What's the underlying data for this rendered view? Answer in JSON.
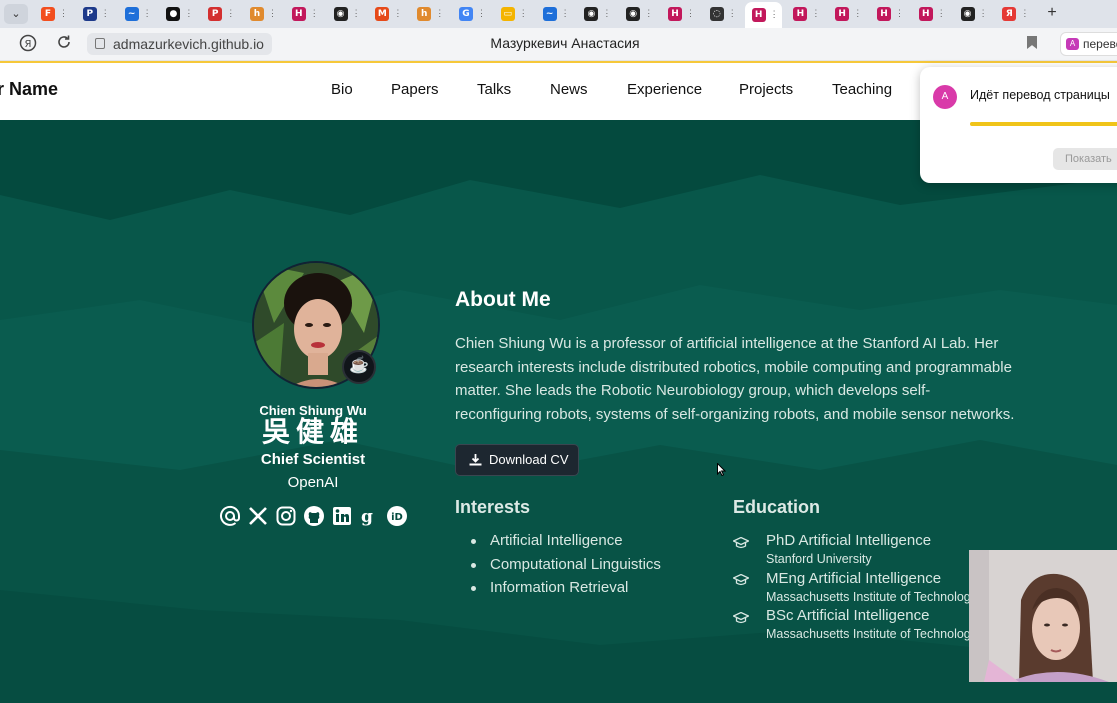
{
  "browser": {
    "tabs": [
      {
        "icon": "tab-list-dropdown-icon"
      },
      {
        "icon": "figma-favicon",
        "color": "#f24e1e",
        "letter": "F"
      },
      {
        "icon": "paypal-favicon",
        "color": "#1e3a8a",
        "letter": "P"
      },
      {
        "icon": "wave-favicon",
        "color": "#1e6fd9",
        "letter": "~"
      },
      {
        "icon": "circle-favicon",
        "color": "#111111",
        "letter": "●"
      },
      {
        "icon": "pdf-favicon",
        "color": "#d32f2f",
        "letter": "P"
      },
      {
        "icon": "hm-favicon",
        "color": "#e08a2e",
        "letter": "h"
      },
      {
        "icon": "h-favicon",
        "color": "#c2185b",
        "letter": "H"
      },
      {
        "icon": "github-favicon",
        "color": "#222222",
        "letter": "◉"
      },
      {
        "icon": "gmail-favicon",
        "color": "#e64a19",
        "letter": "M"
      },
      {
        "icon": "hm-favicon",
        "color": "#e08a2e",
        "letter": "h"
      },
      {
        "icon": "google-favicon",
        "color": "#4285f4",
        "letter": "G"
      },
      {
        "icon": "slides-favicon",
        "color": "#f4b400",
        "letter": "▭"
      },
      {
        "icon": "wave-favicon",
        "color": "#1e6fd9",
        "letter": "~"
      },
      {
        "icon": "github-favicon",
        "color": "#222222",
        "letter": "◉"
      },
      {
        "icon": "github-favicon",
        "color": "#222222",
        "letter": "◉"
      },
      {
        "icon": "h-favicon",
        "color": "#c2185b",
        "letter": "H"
      },
      {
        "icon": "loading-favicon",
        "color": "#333333",
        "letter": "◌"
      },
      {
        "icon": "h-favicon",
        "color": "#c2185b",
        "letter": "H",
        "active": true
      },
      {
        "icon": "h-favicon",
        "color": "#c2185b",
        "letter": "H"
      },
      {
        "icon": "h-favicon",
        "color": "#c2185b",
        "letter": "H"
      },
      {
        "icon": "h-favicon",
        "color": "#c2185b",
        "letter": "H"
      },
      {
        "icon": "h-favicon",
        "color": "#c2185b",
        "letter": "H"
      },
      {
        "icon": "github-favicon",
        "color": "#222222",
        "letter": "◉"
      },
      {
        "icon": "yandex-favicon",
        "color": "#e53935",
        "letter": "Я"
      }
    ],
    "url": "admazurkevich.github.io",
    "page_title": "Мазуркевич Анастасия",
    "translate_button": "перевод"
  },
  "translation_popup": {
    "message": "Идёт перевод страницы",
    "progress": 1.0,
    "show_button": "Показать"
  },
  "site": {
    "name": "ur Name",
    "nav": [
      "Bio",
      "Papers",
      "Talks",
      "News",
      "Experience",
      "Projects",
      "Teaching"
    ]
  },
  "profile": {
    "name": "Chien Shiung Wu",
    "name_cn": "吳健雄",
    "role": "Chief Scientist",
    "organization": "OpenAI",
    "social_icons": [
      "email-icon",
      "x-twitter-icon",
      "instagram-icon",
      "github-icon",
      "linkedin-icon",
      "google-scholar-icon",
      "orcid-icon"
    ]
  },
  "about": {
    "title": "About Me",
    "text": "Chien Shiung Wu is a professor of artificial intelligence at the Stanford AI Lab. Her research interests include distributed robotics, mobile computing and programmable matter. She leads the Robotic Neurobiology group, which develops self-reconfiguring robots, systems of self-organizing robots, and mobile sensor networks.",
    "download_cv": "Download CV"
  },
  "interests": {
    "title": "Interests",
    "items": [
      "Artificial Intelligence",
      "Computational Linguistics",
      "Information Retrieval"
    ]
  },
  "education": {
    "title": "Education",
    "items": [
      {
        "degree": "PhD Artificial Intelligence",
        "school": "Stanford University"
      },
      {
        "degree": "MEng Artificial Intelligence",
        "school": "Massachusetts Institute of Technolog"
      },
      {
        "degree": "BSc Artificial Intelligence",
        "school": "Massachusetts Institute of Technolog"
      }
    ]
  },
  "colors": {
    "hero_bg": "#044a3e",
    "accent_yellow": "#f6c83a"
  }
}
